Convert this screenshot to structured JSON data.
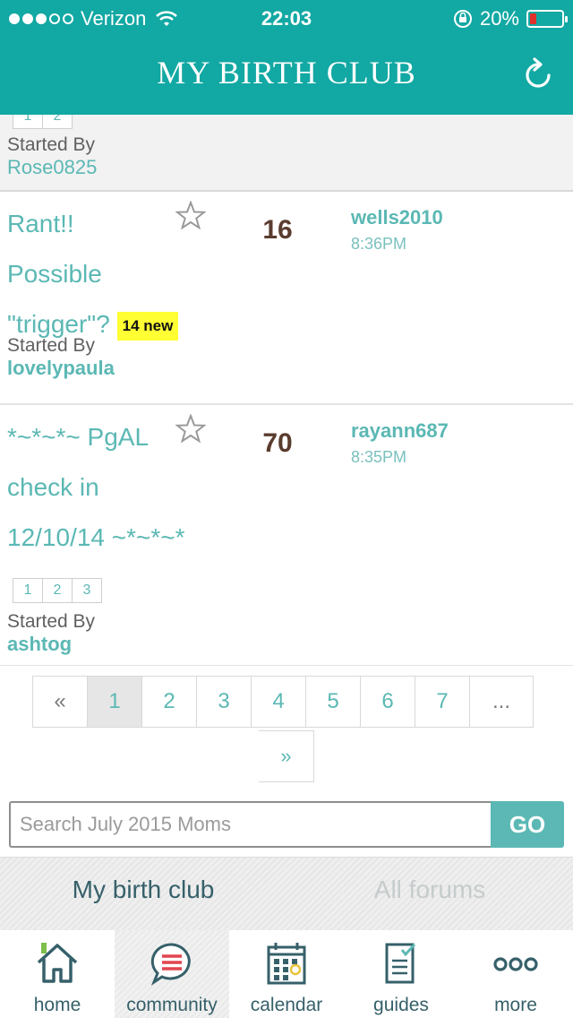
{
  "status_bar": {
    "carrier": "Verizon",
    "time": "22:03",
    "battery": "20%",
    "battery_level": 0.2,
    "signal_bars": 3
  },
  "header": {
    "title": "MY BIRTH CLUB",
    "refresh_icon": "refresh-icon"
  },
  "threads": [
    {
      "pages": [
        "1",
        "2"
      ],
      "started_by_label": "Started By",
      "started_by": "Rose0825"
    },
    {
      "title_lines": [
        "Rant!!",
        "Possible",
        "\"trigger\"?"
      ],
      "new_badge": "14 new",
      "reply_count": "16",
      "last_user": "wells2010",
      "last_time": "8:36PM",
      "started_by_label": "Started By",
      "started_by": "lovelypaula"
    },
    {
      "title_lines": [
        "*~*~*~ PgAL",
        "check in",
        "12/10/14 ~*~*~*"
      ],
      "reply_count": "70",
      "last_user": "rayann687",
      "last_time": "8:35PM",
      "pages": [
        "1",
        "2",
        "3"
      ],
      "started_by_label": "Started By",
      "started_by": "ashtog"
    }
  ],
  "pagination": {
    "prev": "«",
    "pages": [
      "1",
      "2",
      "3",
      "4",
      "5",
      "6",
      "7"
    ],
    "ellipsis": "...",
    "next": "»",
    "current": "1"
  },
  "search": {
    "placeholder": "Search July 2015 Moms",
    "value": "",
    "button": "GO"
  },
  "segmented_tabs": {
    "active": "My birth club",
    "inactive": "All forums"
  },
  "tab_bar": [
    {
      "label": "home",
      "icon": "home-icon"
    },
    {
      "label": "community",
      "icon": "chat-bubble-icon"
    },
    {
      "label": "calendar",
      "icon": "calendar-icon"
    },
    {
      "label": "guides",
      "icon": "guide-document-icon"
    },
    {
      "label": "more",
      "icon": "more-dots-icon"
    }
  ],
  "colors": {
    "header": "#12a8a3",
    "accent": "#5bb8b4",
    "count": "#5a3c2e",
    "new_badge": "#ffff33",
    "tab_icon": "#36606a"
  }
}
